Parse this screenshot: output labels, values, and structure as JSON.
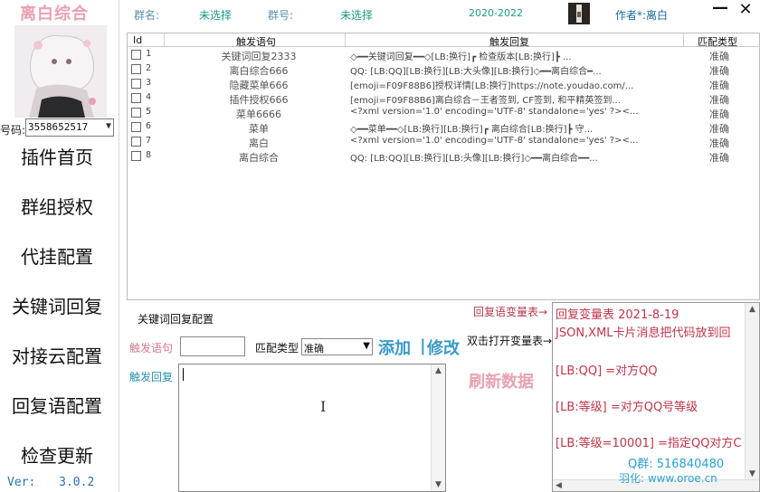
{
  "app": {
    "title": "离白综合",
    "version_label": "Ver:",
    "version": "3.0.2"
  },
  "sidebar": {
    "qq_label": "号码:",
    "qq_value": "3558652517",
    "items": [
      {
        "label": "插件首页"
      },
      {
        "label": "群组授权"
      },
      {
        "label": "代挂配置"
      },
      {
        "label": "关键词回复"
      },
      {
        "label": "对接云配置"
      },
      {
        "label": "回复语配置"
      },
      {
        "label": "检查更新"
      }
    ]
  },
  "header": {
    "group_name_label": "群名:",
    "group_name_value": "未选择",
    "group_id_label": "群号:",
    "group_id_value": "未选择",
    "year_range": "2020-2022",
    "author": "作者*:离白",
    "minimize": "—",
    "close": "✕"
  },
  "table": {
    "headers": {
      "id": "Id",
      "trigger": "触发语句",
      "reply": "触发回复",
      "match": "匹配类型"
    },
    "rows": [
      {
        "id": "1",
        "trigger": "关键词回复2333",
        "reply": "◇━━关键词回复━━◇[LB:换行]┏ 检查版本[LB:换行]┣ ...",
        "match": "准确"
      },
      {
        "id": "2",
        "trigger": "离白综合666",
        "reply": "QQ: [LB:QQ][LB:换行][LB:大头像][LB:换行]◇━━离白综合━...",
        "match": "准确"
      },
      {
        "id": "3",
        "trigger": "隐藏菜单666",
        "reply": "[emoji=F09F88B6]授权详情[LB:换行]https://note.youdao.com/...",
        "match": "准确"
      },
      {
        "id": "4",
        "trigger": "插件授权666",
        "reply": "[emoji=F09F88B6]离白综合－王者签到, CF签到, 和平精英签到...",
        "match": "准确"
      },
      {
        "id": "5",
        "trigger": "菜单6666",
        "reply": "<?xml version='1.0' encoding='UTF-8' standalone='yes' ?><...",
        "match": "准确"
      },
      {
        "id": "6",
        "trigger": "菜单",
        "reply": "◇━━菜单━━◇[LB:换行][LB:换行]┏ 离白综合[LB:换行]┣ 守...",
        "match": "准确"
      },
      {
        "id": "7",
        "trigger": "离白",
        "reply": "<?xml version='1.0' encoding='UTF-8' standalone='yes' ?><...",
        "match": "准确"
      },
      {
        "id": "8",
        "trigger": "离白综合",
        "reply": "QQ: [LB:QQ][LB:换行][LB:头像][LB:换行]◇━━离白综合━━...",
        "match": "准确"
      }
    ]
  },
  "config": {
    "title": "关键词回复配置",
    "trigger_label": "触发语句",
    "trigger_value": "",
    "match_label": "匹配类型",
    "match_value": "准确",
    "add_label": "添加",
    "sep": "|",
    "edit_label": "修改",
    "reply_label": "触发回复",
    "reply_value": ""
  },
  "variables": {
    "link_table": "回复语变量表→",
    "link_open": "双击打开变量表→",
    "refresh": "刷新数据",
    "lines": [
      "  回复变量表 2021-8-19",
      "JSON,XML卡片消息把代码放到回",
      "",
      "[LB:QQ]  =对方QQ",
      "",
      "[LB:等级]  =对方QQ号等级",
      "",
      "[LB:等级=10001]  =指定QQ对方C"
    ],
    "qgroup": "Q群: 516840480",
    "yuhua": "羽化: www.oroe.cn"
  },
  "colors": {
    "accent_pink": "#e8a2b2",
    "accent_blue": "#3a9ac8",
    "var_red": "#c0354a"
  }
}
